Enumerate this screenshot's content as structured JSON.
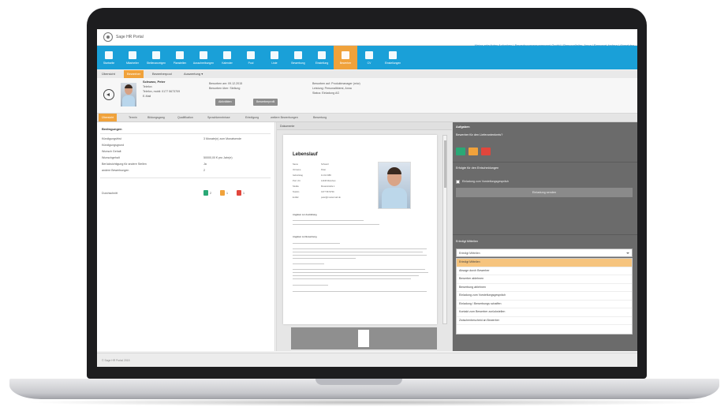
{
  "app": {
    "logo_text": "Sage HR Portal",
    "top_links": "Meine erledigten Aufgaben | Bewerbungsmanagement GmbH | Personalleiter, Anna | Passwort ändern | Abmelden"
  },
  "nav": {
    "items": [
      {
        "label": "Startseite",
        "icon": "home-icon"
      },
      {
        "label": "Mitarbeiter",
        "icon": "person-icon"
      },
      {
        "label": "Stellenanzeigen",
        "icon": "document-icon"
      },
      {
        "label": "Planstellen",
        "icon": "chart-icon"
      },
      {
        "label": "Ausschreibungen",
        "icon": "megaphone-icon"
      },
      {
        "label": "Kalender",
        "icon": "calendar-icon"
      },
      {
        "label": "Pool",
        "icon": "pool-icon"
      },
      {
        "label": "Liste",
        "icon": "flag-icon"
      },
      {
        "label": "Bewerbung",
        "icon": "group-icon"
      },
      {
        "label": "Einstellung",
        "icon": "trend-icon"
      },
      {
        "label": "Bewerber",
        "icon": "folder-icon",
        "active": true
      },
      {
        "label": "CV",
        "icon": "link-icon"
      },
      {
        "label": "Einstellungen",
        "icon": "wrench-icon"
      }
    ]
  },
  "subtabs": [
    {
      "label": "Übersicht"
    },
    {
      "label": "Bewerber",
      "active": true
    },
    {
      "label": "Bewerberpool"
    },
    {
      "label": "Auswertung ▾"
    }
  ],
  "profile": {
    "name": "Schwarz, Peter",
    "lines": [
      "Telefon",
      "Telefon, mobil: 0177 5673709",
      "E-Mail"
    ],
    "col2": [
      "Beworben am: 09.12.2015",
      "Beworben über: Stellung"
    ],
    "col3": [
      "Beworben auf: Produktmanager (m/w)",
      "Leistung: Personaltbierst, Anna",
      "Status: Einladung AG"
    ],
    "btn1": "Aktivitäten",
    "btn2": "Bewerberprofil"
  },
  "page_tabs": [
    {
      "label": "Übersicht",
      "active": true
    },
    {
      "label": "Termin"
    },
    {
      "label": "Bildungsgang"
    },
    {
      "label": "Qualifikation"
    },
    {
      "label": "Sprachkenntnisse"
    },
    {
      "label": "Erledigung"
    },
    {
      "label": "weitere Bewerbungen"
    },
    {
      "label": "Bewertung"
    }
  ],
  "left": {
    "title": "Bedingungen",
    "rows": [
      {
        "label": "Kündigungsfrist",
        "value": "3 Monate(n) zum Monatsende"
      },
      {
        "label": "Kündigungsgrund",
        "value": ""
      },
      {
        "label": "Wunsch Gehalt",
        "value": ""
      },
      {
        "label": "Wunschgehalt",
        "value": "50000,00 € pro Jahr(e)"
      },
      {
        "label": "Berücksichtigung für andere Stellen",
        "value": "Ja"
      },
      {
        "label": "andere Bewerbungen",
        "value": "2"
      }
    ],
    "rating_label": "Durchschnitt",
    "rating_vals": [
      "2",
      "1",
      "1"
    ]
  },
  "middle": {
    "header": "Dokumente",
    "doc_title": "Lebenslauf",
    "doc_fields": [
      {
        "label": "Name",
        "value": "Schwarz"
      },
      {
        "label": "Vorname",
        "value": "Peter"
      },
      {
        "label": "Geburtstag",
        "value": "11.02.1986"
      },
      {
        "label": "PLZ, Ort",
        "value": "12345 München"
      },
      {
        "label": "Straße",
        "value": "Musterstraße 1"
      },
      {
        "label": "Telefon",
        "value": "0177 5673709"
      },
      {
        "label": "E-Mail",
        "value": "peter@mustermail.de"
      }
    ],
    "section1": "Angaben zur Ausbildung",
    "section2": "Angaben zur Bewerbung"
  },
  "right": {
    "title": "Aufgaben",
    "q1": "Bewerber für den Lieferantenkreis?",
    "q2": "Erfolgte für den Entscheidungen",
    "check_label": "Einladung zum Vorstellungsgespräch",
    "invite_btn": "Einladung senden",
    "next_title": "Erledigt Mitteilen",
    "select_value": "Erledigt Mitteilen",
    "options": [
      "Erledigt Mitteilen",
      "Absage durch Bewerber",
      "Bewerber ablehnen",
      "Bewerbung ablehnen",
      "Einladung zum Vorstellungsgespräch",
      "Einladung / Bewerbungs schaffen",
      "Kontakt zum Bewerber zurückstellen",
      "Zwischenbescheid an Bewerber"
    ],
    "action_colors": [
      "#2aa876",
      "#f0a23b",
      "#e1463c"
    ]
  },
  "footer": {
    "text": "© Sage HR Portal 2015"
  }
}
